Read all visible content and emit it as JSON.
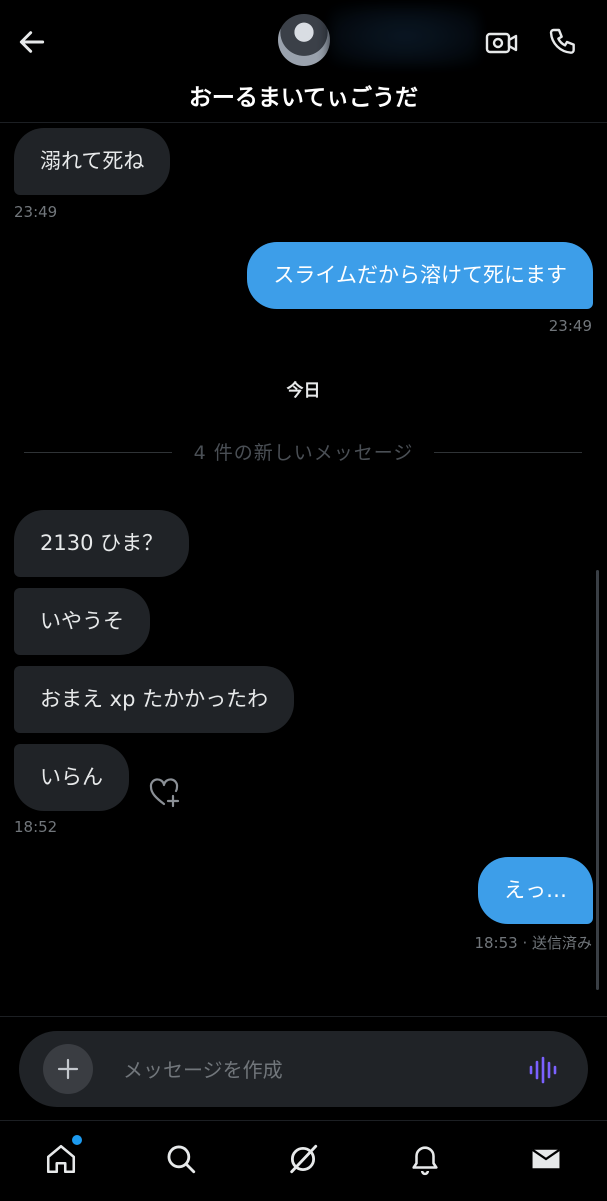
{
  "header": {
    "title": "おーるまいてぃごうだ"
  },
  "messages": {
    "m1": {
      "text": "溺れて死ね",
      "time": "23:49"
    },
    "m2": {
      "text": "スライムだから溶けて死にます",
      "time": "23:49"
    },
    "day_label": "今日",
    "new_divider": "4 件の新しいメッセージ",
    "m3": {
      "text": "2130 ひま？"
    },
    "m4": {
      "text": "いやうそ"
    },
    "m5": {
      "text": "おまえ xp たかかったわ"
    },
    "m6": {
      "text": "いらん",
      "time": "18:52"
    },
    "m7": {
      "text": "えっ…",
      "time": "18:53 · 送信済み"
    }
  },
  "composer": {
    "placeholder": "メッセージを作成"
  },
  "colors": {
    "accent": "#1d9bf0",
    "sent_bubble": "#3d9ee9",
    "received_bubble": "#202327",
    "voice_icon": "#7b61ff"
  },
  "nav": {
    "items": [
      "home-icon",
      "search-icon",
      "grok-icon",
      "bell-icon",
      "mail-icon"
    ],
    "active": "mail-icon",
    "home_has_notification": true
  }
}
